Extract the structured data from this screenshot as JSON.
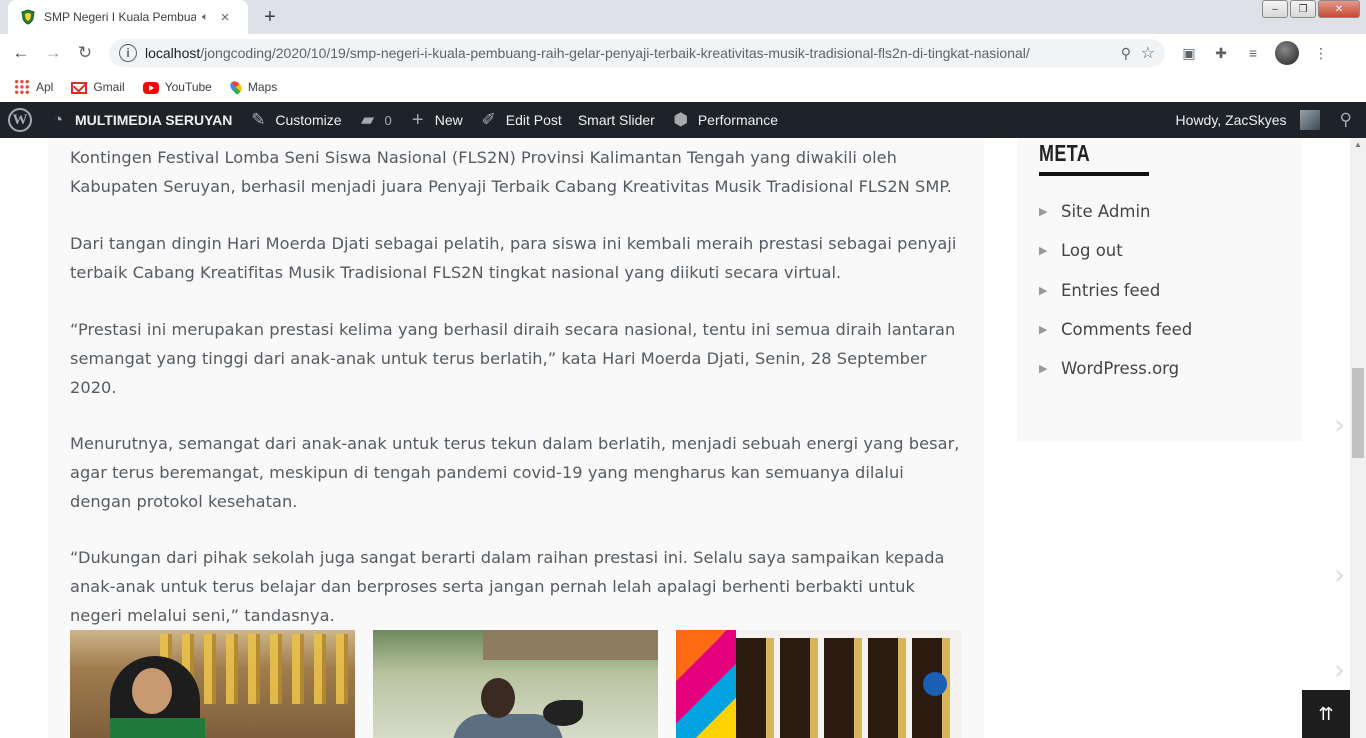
{
  "browser": {
    "tab_title": "SMP Negeri I Kuala Pembuang",
    "tab_close": "×",
    "new_tab": "+",
    "url_host": "localhost",
    "url_path": "/jongcoding/2020/10/19/smp-negeri-i-kuala-pembuang-raih-gelar-penyaji-terbaik-kreativitas-musik-tradisional-fls2n-di-tingkat-nasional/",
    "bookmarks": [
      {
        "label": "Apl",
        "icon": "apps-grid-icon"
      },
      {
        "label": "Gmail",
        "icon": "gmail-icon"
      },
      {
        "label": "YouTube",
        "icon": "youtube-icon"
      },
      {
        "label": "Maps",
        "icon": "maps-icon"
      }
    ]
  },
  "adminbar": {
    "site_name": "MULTIMEDIA SERUYAN",
    "customize": "Customize",
    "comments_count": "0",
    "new": "New",
    "edit_post": "Edit Post",
    "smart_slider": "Smart Slider",
    "performance": "Performance",
    "howdy": "Howdy, ZacSkyes"
  },
  "article": {
    "paragraphs": [
      "Kontingen Festival Lomba Seni Siswa Nasional (FLS2N) Provinsi Kalimantan Tengah yang diwakili oleh Kabupaten Seruyan, berhasil menjadi juara Penyaji Terbaik Cabang Kreativitas Musik Tradisional FLS2N SMP.",
      "Dari tangan dingin Hari Moerda Djati sebagai pelatih, para siswa ini kembali meraih prestasi sebagai penyaji terbaik Cabang Kreatifitas Musik Tradisional FLS2N tingkat nasional yang diikuti secara virtual.",
      "“Prestasi ini merupakan prestasi  kelima yang berhasil diraih secara nasional, tentu  ini semua diraih lantaran semangat yang tinggi dari anak-anak  untuk terus berlatih,” kata Hari Moerda Djati, Senin, 28 September 2020.",
      "Menurutnya, semangat dari anak-anak untuk terus tekun dalam berlatih, menjadi sebuah energi yang besar, agar terus beremangat, meskipun di tengah pandemi covid-19 yang mengharus kan semuanya dilalui dengan protokol kesehatan.",
      "“Dukungan dari pihak sekolah juga sangat berarti dalam raihan prestasi ini. Selalu saya sampaikan kepada anak-anak untuk terus belajar dan berproses serta jangan pernah lelah apalagi berhenti berbakti untuk negeri melalui seni,” tandasnya."
    ]
  },
  "sidebar": {
    "title": "META",
    "items": [
      "Site Admin",
      "Log out",
      "Entries feed",
      "Comments feed",
      "WordPress.org"
    ]
  },
  "ui": {
    "to_top": "⇈"
  }
}
